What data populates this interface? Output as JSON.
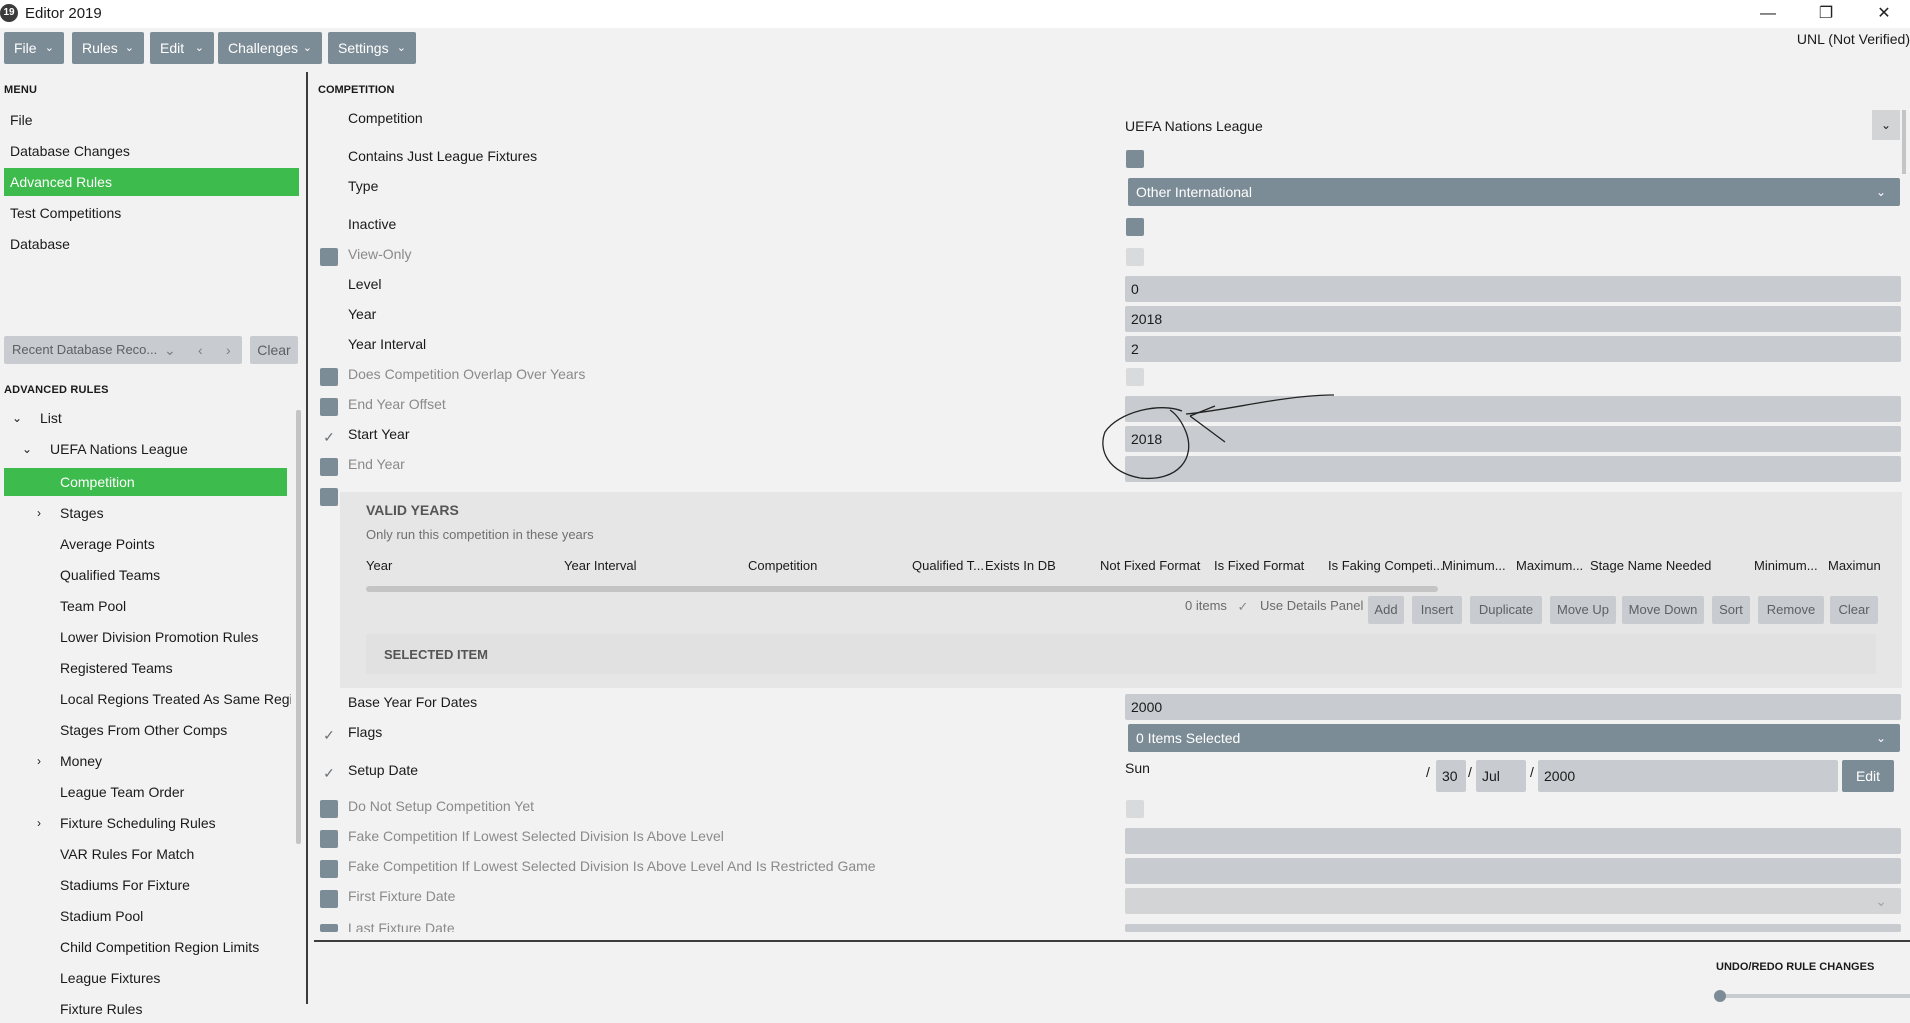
{
  "window": {
    "title": "Editor 2019",
    "icon_text": "19",
    "minimize": "—",
    "restore": "❐",
    "close": "✕"
  },
  "toolbar": {
    "items": [
      "File",
      "Rules",
      "Edit",
      "Challenges",
      "Settings"
    ]
  },
  "verification_status": "UNL (Not Verified)",
  "menu": {
    "title": "MENU",
    "items": [
      "File",
      "Database Changes",
      "Advanced Rules",
      "Test Competitions",
      "Database"
    ],
    "selected": "Advanced Rules"
  },
  "recent": {
    "placeholder": "Recent Database Reco...",
    "clear_label": "Clear"
  },
  "advanced_rules": {
    "title": "ADVANCED RULES",
    "tree": {
      "list_label": "List",
      "competition_label": "UEFA Nations League",
      "selected": "Competition",
      "children": [
        "Competition",
        "Stages",
        "Average Points",
        "Qualified Teams",
        "Team Pool",
        "Lower Division Promotion Rules",
        "Registered Teams",
        "Local Regions Treated As Same Regior",
        "Stages From Other Comps",
        "Money",
        "League Team Order",
        "Fixture Scheduling Rules",
        "VAR Rules For Match",
        "Stadiums For Fixture",
        "Stadium Pool",
        "Child Competition Region Limits",
        "League Fixtures",
        "Fixture Rules"
      ]
    }
  },
  "competition": {
    "section_title": "COMPETITION",
    "labels": {
      "competition": "Competition",
      "contains_league_fixtures": "Contains Just League Fixtures",
      "type": "Type",
      "inactive": "Inactive",
      "view_only": "View-Only",
      "level": "Level",
      "year": "Year",
      "year_interval": "Year Interval",
      "overlap": "Does Competition Overlap Over Years",
      "end_year_offset": "End Year Offset",
      "start_year": "Start Year",
      "end_year": "End Year",
      "base_year": "Base Year For Dates",
      "flags": "Flags",
      "setup_date": "Setup Date",
      "do_not_setup": "Do Not Setup Competition Yet",
      "fake_comp": "Fake Competition If Lowest Selected Division Is Above Level",
      "fake_comp_restricted": "Fake Competition If Lowest Selected Division Is Above Level And Is Restricted Game",
      "first_fixture": "First Fixture Date",
      "last_fixture": "Last Fixture Date"
    },
    "values": {
      "competition": "UEFA Nations League",
      "type": "Other International",
      "level": "0",
      "year": "2018",
      "year_interval": "2",
      "start_year": "2018",
      "base_year": "2000",
      "flags": "0 Items Selected",
      "setup_day_name": "Sun",
      "setup_day": "30",
      "setup_month": "Jul",
      "setup_year": "2000",
      "edit_label": "Edit",
      "date_sep": "/"
    }
  },
  "valid_years": {
    "title": "VALID YEARS",
    "subtitle": "Only run this competition in these years",
    "columns": [
      "Year",
      "Year Interval",
      "Competition",
      "Qualified T...",
      "Exists In DB",
      "Not Fixed Format",
      "Is Fixed Format",
      "Is Faking Competi...",
      "Minimum...",
      "Maximum...",
      "Stage Name Needed",
      "Minimum...",
      "Maximun"
    ],
    "items_count": "0 items",
    "use_details_panel": "Use Details Panel",
    "actions": [
      "Add",
      "Insert",
      "Duplicate",
      "Move Up",
      "Move Down",
      "Sort",
      "Remove",
      "Clear"
    ],
    "selected_item_title": "SELECTED ITEM"
  },
  "undo": {
    "title": "UNDO/REDO RULE CHANGES"
  },
  "icons": {
    "chevron": "chevron-down-icon",
    "check": "check-icon",
    "arrow": "tree-arrow-icon"
  },
  "colors": {
    "accent_green": "#3dbb4c",
    "control_slate": "#7c8c96",
    "field_bg": "#c8ccd0"
  }
}
